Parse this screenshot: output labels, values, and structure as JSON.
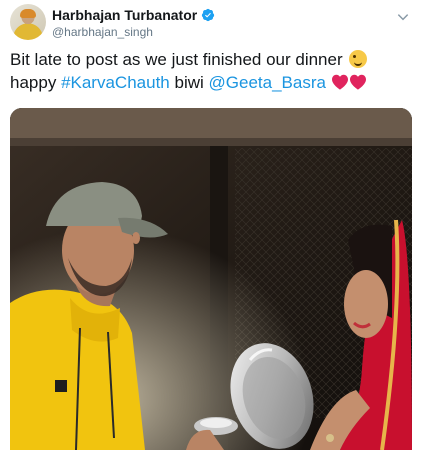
{
  "author": {
    "display_name": "Harbhajan Turbanator",
    "handle": "@harbhajan_singh",
    "verified_icon": "verified-badge-icon"
  },
  "tweet": {
    "text_before": "Bit late to post as we just finished our dinner",
    "emoji": "winking-face-tongue",
    "text_after": "happy",
    "hashtag": "#KarvaChauth",
    "word": "biwi",
    "mention": "@Geeta_Basra",
    "hearts": [
      "heart-icon",
      "heart-icon"
    ]
  },
  "colors": {
    "link": "#1b95e0",
    "verified": "#1da1f2",
    "heart": "#e0245e",
    "text": "#14171a",
    "muted": "#657786"
  },
  "media": {
    "type": "photo",
    "icon": "photo-icon"
  }
}
